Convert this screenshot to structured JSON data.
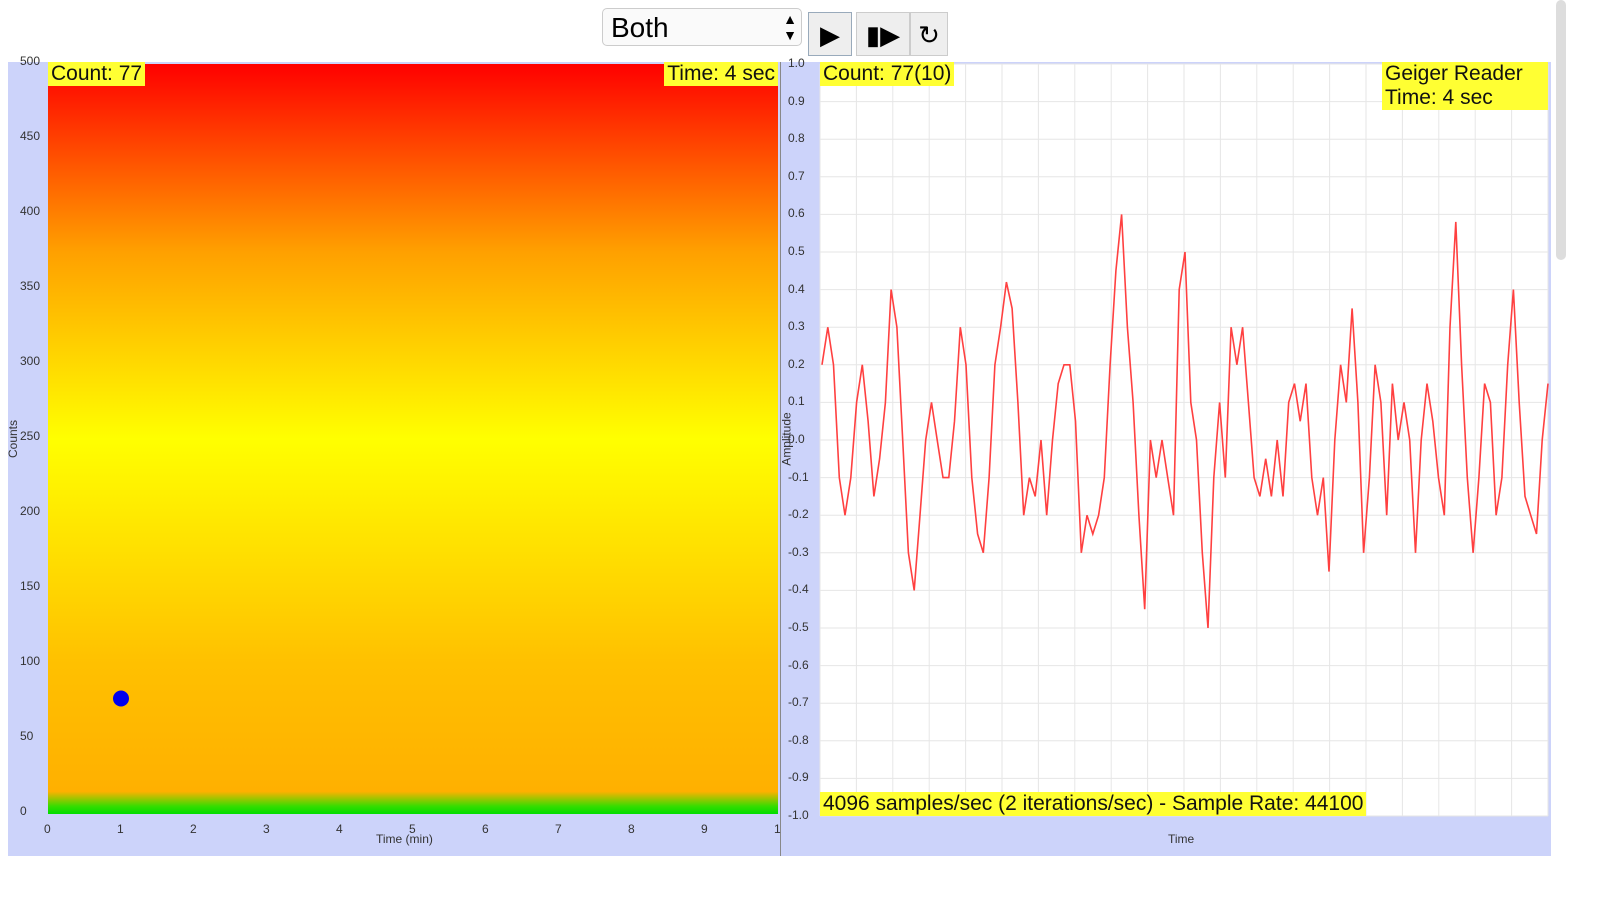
{
  "controls": {
    "mode_select": "Both",
    "play": "▶",
    "step": "▮▶",
    "reset": "↻"
  },
  "left": {
    "count_label": "Count: 77",
    "time_label": "Time: 4 sec"
  },
  "right": {
    "count_label": "Count: 77(10)",
    "title": "Geiger Reader",
    "time_label": "Time: 4 sec",
    "footer": "4096 samples/sec (2 iterations/sec) - Sample Rate: 44100"
  },
  "chart_data": [
    {
      "type": "scatter",
      "title": "",
      "xlabel": "Time (min)",
      "ylabel": "Counts",
      "xlim": [
        0,
        10
      ],
      "ylim": [
        0,
        500
      ],
      "xticks": [
        "0",
        "1",
        "2",
        "3",
        "4",
        "5",
        "6",
        "7",
        "8",
        "9",
        "1"
      ],
      "yticks": [
        "0",
        "50",
        "100",
        "150",
        "200",
        "250",
        "300",
        "350",
        "400",
        "450",
        "500"
      ],
      "points": [
        {
          "x": 1,
          "y": 77
        }
      ],
      "point_color": "#0000ee",
      "background_gradient": [
        "#00dd00",
        "#ffb000",
        "#ffff00",
        "#ff0000"
      ]
    },
    {
      "type": "line",
      "xlabel": "Time",
      "ylabel": "Amplitude",
      "ylim": [
        -1,
        1
      ],
      "grid": true,
      "color": "#ff4040",
      "yticks": [
        "1.0",
        "0.9",
        "0.8",
        "0.7",
        "0.6",
        "0.5",
        "0.4",
        "0.3",
        "0.2",
        "0.1",
        "0.0",
        "-0.1",
        "-0.2",
        "-0.3",
        "-0.4",
        "-0.5",
        "-0.6",
        "-0.7",
        "-0.8",
        "-0.9",
        "-1.0"
      ],
      "values": [
        0.2,
        0.3,
        0.2,
        -0.1,
        -0.2,
        -0.1,
        0.1,
        0.2,
        0.05,
        -0.15,
        -0.05,
        0.1,
        0.4,
        0.3,
        0.0,
        -0.3,
        -0.4,
        -0.2,
        0.0,
        0.1,
        0.0,
        -0.1,
        -0.1,
        0.05,
        0.3,
        0.2,
        -0.1,
        -0.25,
        -0.3,
        -0.1,
        0.2,
        0.3,
        0.42,
        0.35,
        0.1,
        -0.2,
        -0.1,
        -0.15,
        0.0,
        -0.2,
        0.0,
        0.15,
        0.2,
        0.2,
        0.05,
        -0.3,
        -0.2,
        -0.25,
        -0.2,
        -0.1,
        0.2,
        0.45,
        0.6,
        0.3,
        0.1,
        -0.2,
        -0.45,
        0.0,
        -0.1,
        0.0,
        -0.1,
        -0.2,
        0.4,
        0.5,
        0.1,
        0.0,
        -0.3,
        -0.5,
        -0.1,
        0.1,
        -0.1,
        0.3,
        0.2,
        0.3,
        0.1,
        -0.1,
        -0.15,
        -0.05,
        -0.15,
        0.0,
        -0.15,
        0.1,
        0.15,
        0.05,
        0.15,
        -0.1,
        -0.2,
        -0.1,
        -0.35,
        0.0,
        0.2,
        0.1,
        0.35,
        0.1,
        -0.3,
        -0.1,
        0.2,
        0.1,
        -0.2,
        0.15,
        0.0,
        0.1,
        0.0,
        -0.3,
        0.0,
        0.15,
        0.05,
        -0.1,
        -0.2,
        0.3,
        0.58,
        0.2,
        -0.1,
        -0.3,
        -0.1,
        0.15,
        0.1,
        -0.2,
        -0.1,
        0.2,
        0.4,
        0.1,
        -0.15,
        -0.2,
        -0.25,
        0.0,
        0.15
      ]
    }
  ]
}
